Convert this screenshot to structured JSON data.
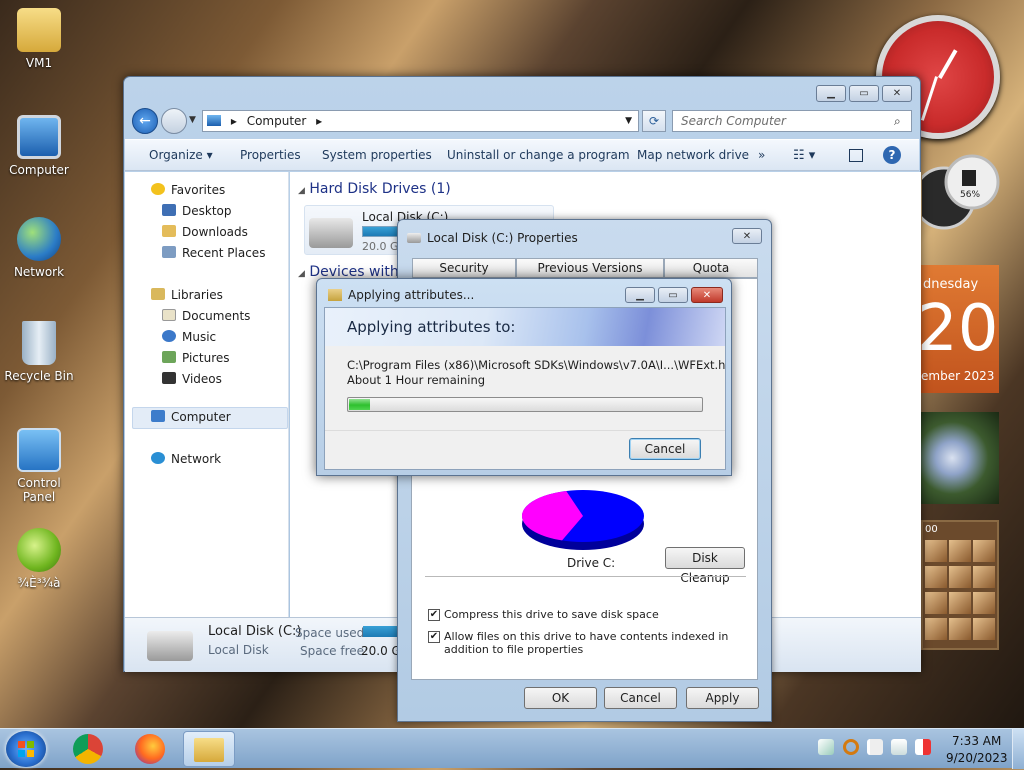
{
  "desktop": {
    "icons": [
      {
        "label": "VM1"
      },
      {
        "label": "Computer"
      },
      {
        "label": "Network"
      },
      {
        "label": "Recycle Bin"
      },
      {
        "label": "Control Panel"
      },
      {
        "label": "¾È³¾à"
      }
    ]
  },
  "gadgets": {
    "calendar": {
      "weekday": "dnesday",
      "day": "20",
      "month": "ember 2023"
    },
    "meter_percent": "56%",
    "puzzle_time": "00"
  },
  "explorer": {
    "address": {
      "path": "Computer",
      "separator": "▸"
    },
    "search_placeholder": "Search Computer",
    "toolbar": {
      "organize": "Organize ▾",
      "properties": "Properties",
      "system_properties": "System properties",
      "uninstall": "Uninstall or change a program",
      "map_drive": "Map network drive",
      "more": "»"
    },
    "nav": {
      "favorites": "Favorites",
      "desktop": "Desktop",
      "downloads": "Downloads",
      "recent": "Recent Places",
      "libraries": "Libraries",
      "documents": "Documents",
      "music": "Music",
      "pictures": "Pictures",
      "videos": "Videos",
      "computer": "Computer",
      "network": "Network"
    },
    "content": {
      "hdd_group": "Hard Disk Drives (1)",
      "drive_name": "Local Disk (C:)",
      "drive_size": "20.0 GB",
      "devices_group": "Devices with"
    },
    "details": {
      "name": "Local Disk (C:)",
      "type": "Local Disk",
      "space_used_label": "Space used:",
      "space_free_label": "Space free:",
      "space_free_value": "20.0 GB"
    }
  },
  "properties": {
    "title": "Local Disk (C:) Properties",
    "tabs": [
      "Security",
      "Previous Versions",
      "Quota"
    ],
    "drive_label": "Drive C:",
    "disk_cleanup": "Disk Cleanup",
    "compress_label": "Compress this drive to save disk space",
    "index_label": "Allow files on this drive to have contents indexed in addition to file properties",
    "buttons": {
      "ok": "OK",
      "cancel": "Cancel",
      "apply": "Apply"
    },
    "pie": {
      "used_fraction": 0.4,
      "used_color": "#ff00ff",
      "free_color": "#0000ff"
    }
  },
  "apply_dialog": {
    "title": "Applying attributes...",
    "header": "Applying attributes to:",
    "file": "C:\\Program Files (x86)\\Microsoft SDKs\\Windows\\v7.0A\\I...\\WFExt.h",
    "remaining": "About 1 Hour remaining",
    "progress": 0.06,
    "cancel": "Cancel"
  },
  "taskbar": {
    "time": "7:33 AM",
    "date": "9/20/2023"
  }
}
